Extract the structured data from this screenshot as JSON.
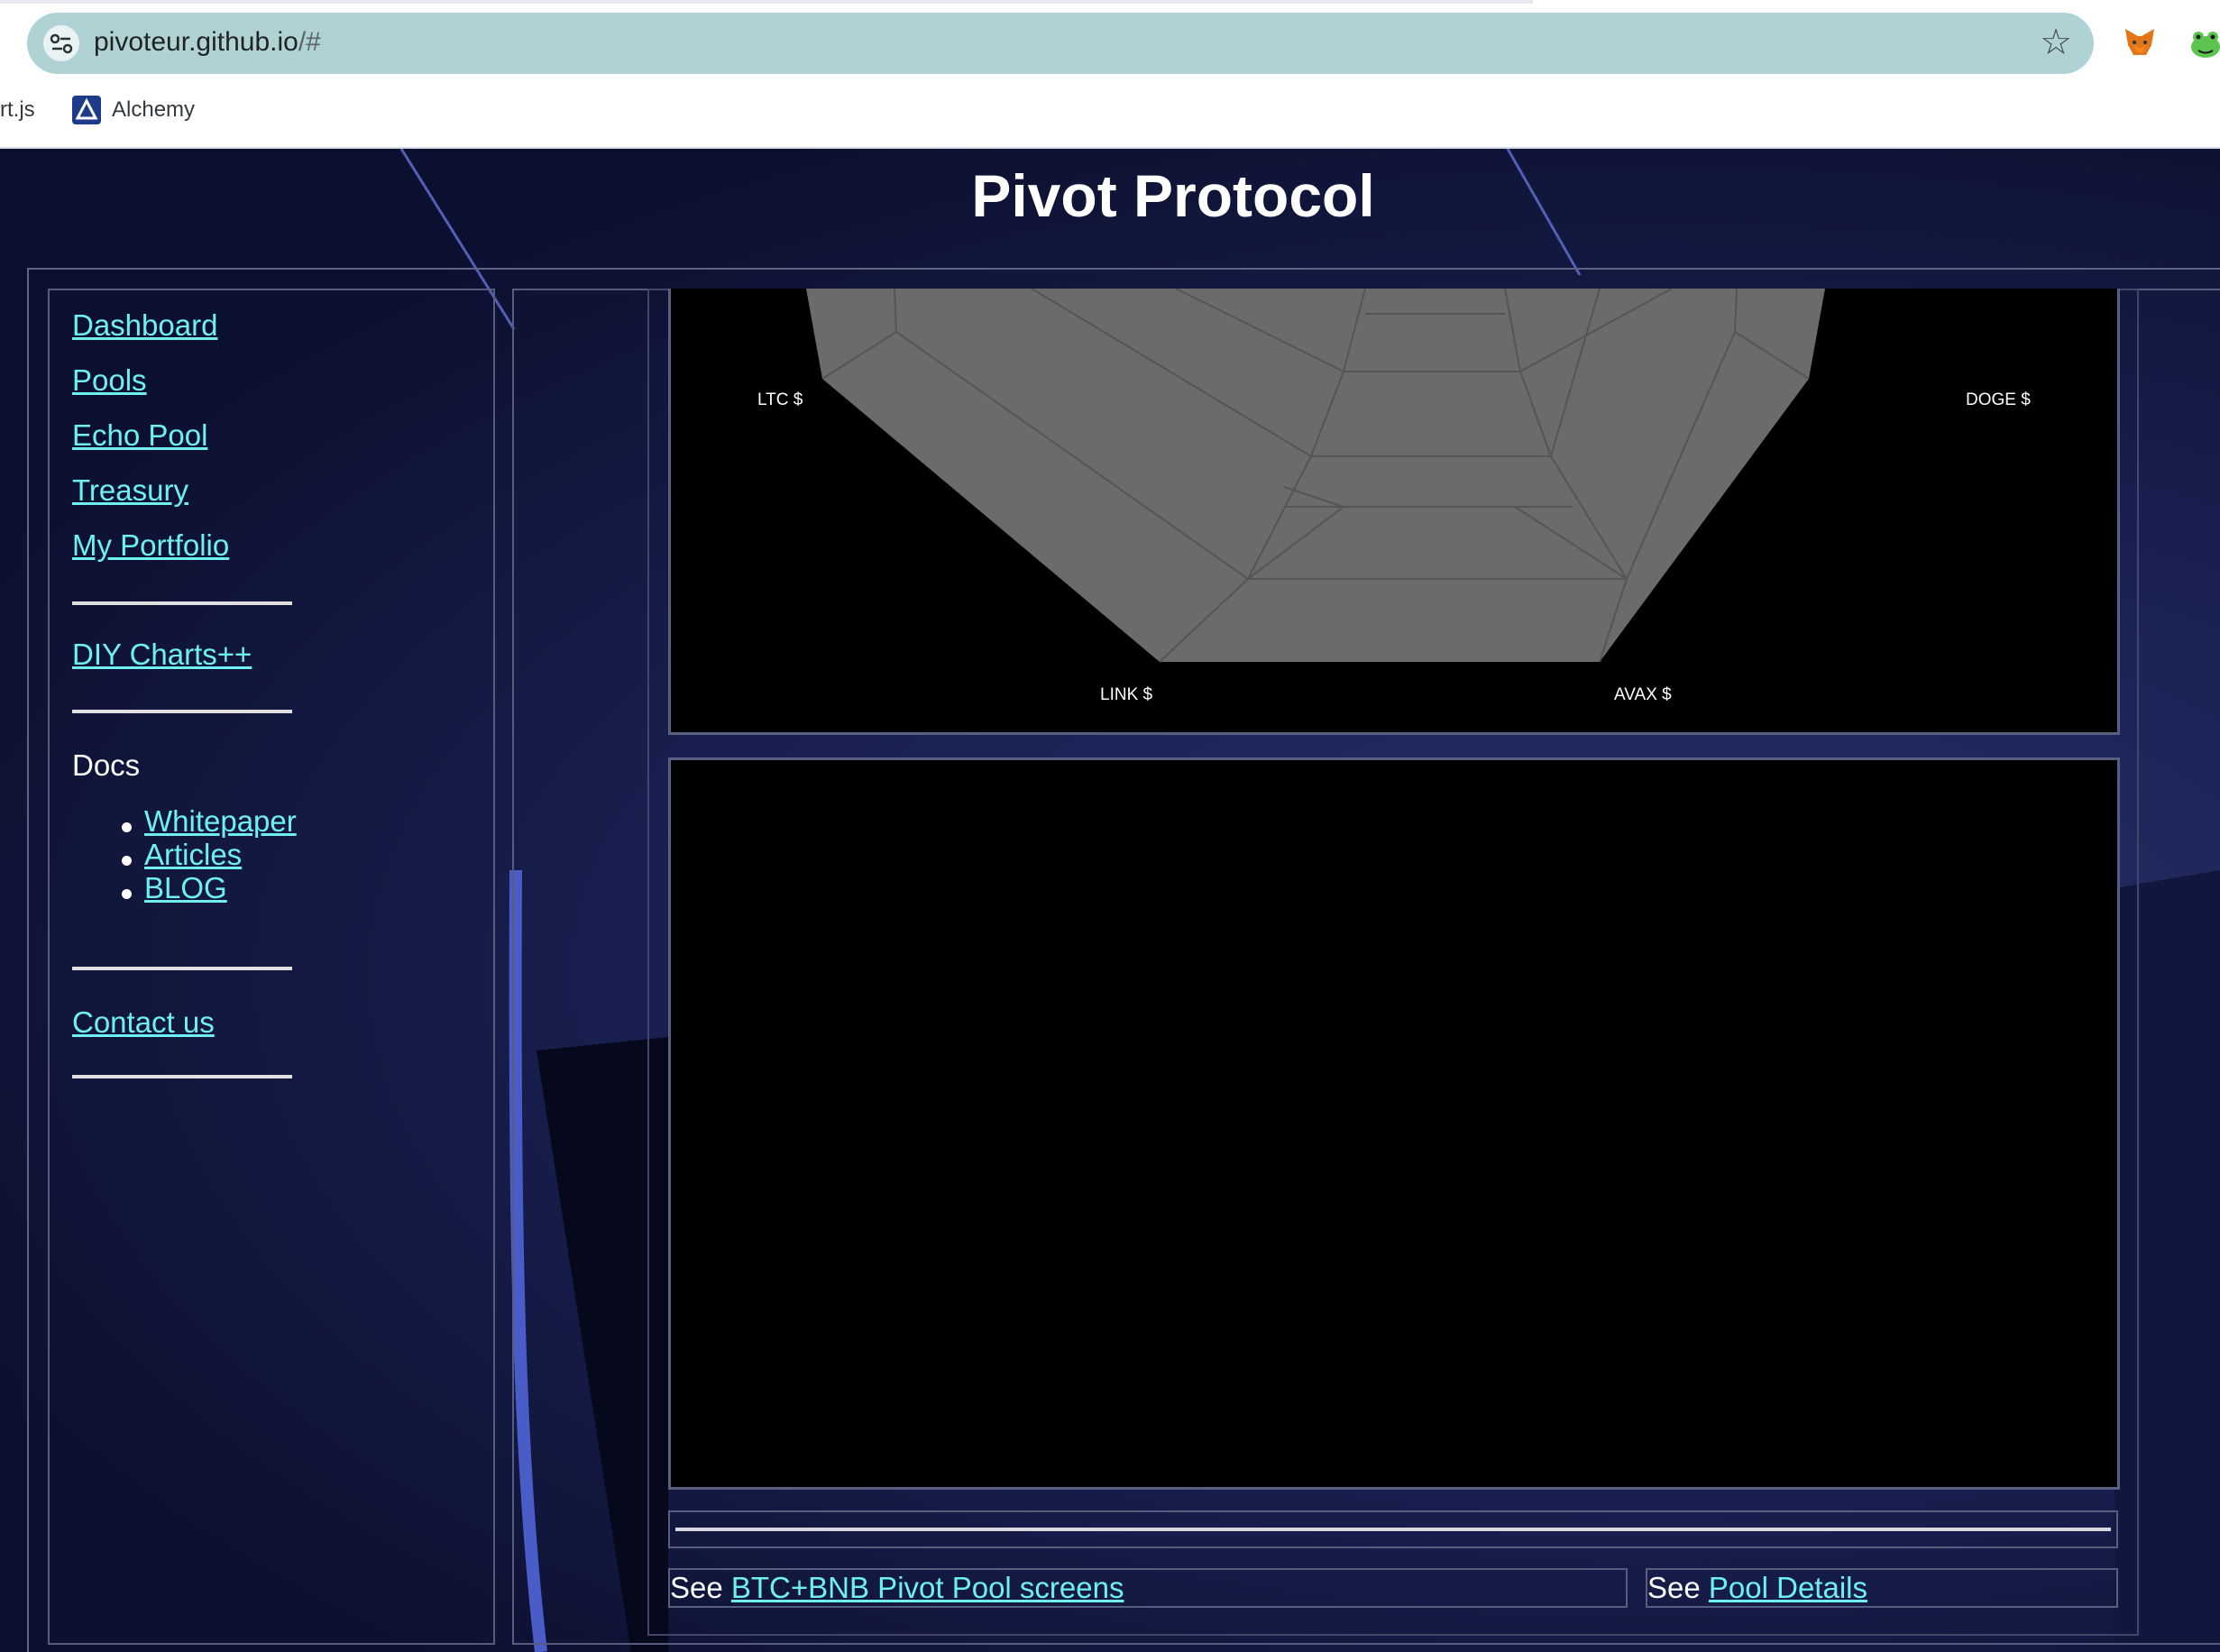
{
  "browser": {
    "url_host": "pivoteur.github.io",
    "url_path": "/#",
    "bookmarks": [
      {
        "label": "rt.js"
      },
      {
        "label": "Alchemy"
      }
    ]
  },
  "site": {
    "title": "Pivot Protocol"
  },
  "nav": {
    "items": [
      {
        "label": "Dashboard"
      },
      {
        "label": "Pools"
      },
      {
        "label": "Echo Pool"
      },
      {
        "label": "Treasury"
      },
      {
        "label": "My Portfolio"
      }
    ],
    "diy": "DIY Charts++",
    "docs_heading": "Docs",
    "docs": [
      {
        "label": "Whitepaper"
      },
      {
        "label": "Articles"
      },
      {
        "label": "BLOG"
      }
    ],
    "contact": "Contact us"
  },
  "radar": {
    "labels": [
      "LTC $",
      "DOGE $",
      "LINK $",
      "AVAX $"
    ],
    "fill_color": "#6b6b6b",
    "grid_color": "#555555"
  },
  "footer_links": {
    "left_prefix": "See",
    "left_link": "BTC+BNB Pivot Pool screens",
    "right_prefix": "See",
    "right_link": "Pool Details"
  },
  "colors": {
    "link": "#6ff0f0",
    "background": "#1a2152"
  }
}
